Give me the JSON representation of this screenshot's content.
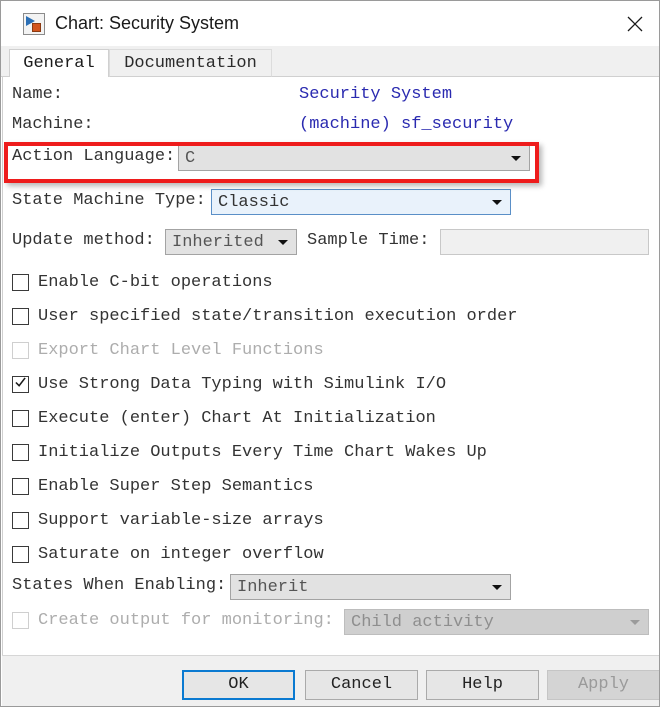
{
  "window": {
    "title": "Chart: Security System",
    "icon": "stateflow-chart-icon",
    "close_label": "×"
  },
  "tabs": [
    {
      "label": "General",
      "active": true
    },
    {
      "label": "Documentation",
      "active": false
    }
  ],
  "fields": {
    "name_label": "Name:",
    "name_value": "Security System",
    "machine_label": "Machine:",
    "machine_value": "(machine) sf_security",
    "action_language_label": "Action Language:",
    "action_language_value": "C",
    "state_machine_type_label": "State Machine Type:",
    "state_machine_type_value": "Classic",
    "update_method_label": "Update method:",
    "update_method_value": "Inherited",
    "sample_time_label": "Sample Time:",
    "sample_time_value": "",
    "states_when_enabling_label": "States When Enabling:",
    "states_when_enabling_value": "Inherit",
    "create_output_label": "Create output for monitoring:",
    "create_output_value": "Child activity"
  },
  "checkboxes": [
    {
      "label": "Enable C-bit operations",
      "checked": false,
      "disabled": false
    },
    {
      "label": "User specified state/transition execution order",
      "checked": false,
      "disabled": false
    },
    {
      "label": "Export Chart Level Functions",
      "checked": false,
      "disabled": true
    },
    {
      "label": "Use Strong Data Typing with Simulink I/O",
      "checked": true,
      "disabled": false
    },
    {
      "label": "Execute (enter) Chart At Initialization",
      "checked": false,
      "disabled": false
    },
    {
      "label": "Initialize Outputs Every Time Chart Wakes Up",
      "checked": false,
      "disabled": false
    },
    {
      "label": "Enable Super Step Semantics",
      "checked": false,
      "disabled": false
    },
    {
      "label": "Support variable-size arrays",
      "checked": false,
      "disabled": false
    },
    {
      "label": "Saturate on integer overflow",
      "checked": false,
      "disabled": false
    }
  ],
  "buttons": {
    "ok": "OK",
    "cancel": "Cancel",
    "help": "Help",
    "apply": "Apply"
  },
  "colors": {
    "link": "#2a2ab0",
    "highlight": "#ee1c1c",
    "focus_border": "#0a7ad1",
    "combo_active_bg": "#e9f2fb"
  }
}
